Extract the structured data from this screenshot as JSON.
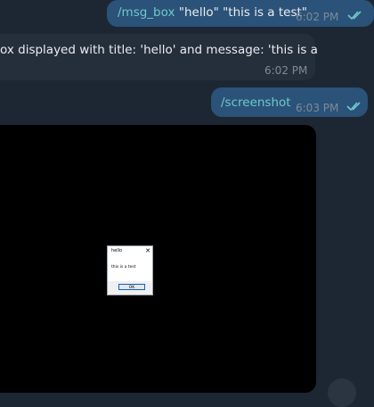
{
  "messages": {
    "msg1": {
      "command": "/msg_box",
      "text": " \"hello\" \"this is a test\"",
      "time": "6:02 PM"
    },
    "msg2": {
      "text": "ox displayed with title: 'hello' and message: 'this is a",
      "time": "6:02 PM"
    },
    "msg3": {
      "command": "/screenshot",
      "time": "6:03 PM"
    }
  },
  "dialog": {
    "title": "hello",
    "close": "✕",
    "message": "this is a test",
    "ok_label": "OK"
  },
  "colors": {
    "background": "#1d2733",
    "outgoing": "#2b5278",
    "incoming": "#252f3b",
    "command": "#6ec9cb",
    "check": "#6ec9cb"
  }
}
